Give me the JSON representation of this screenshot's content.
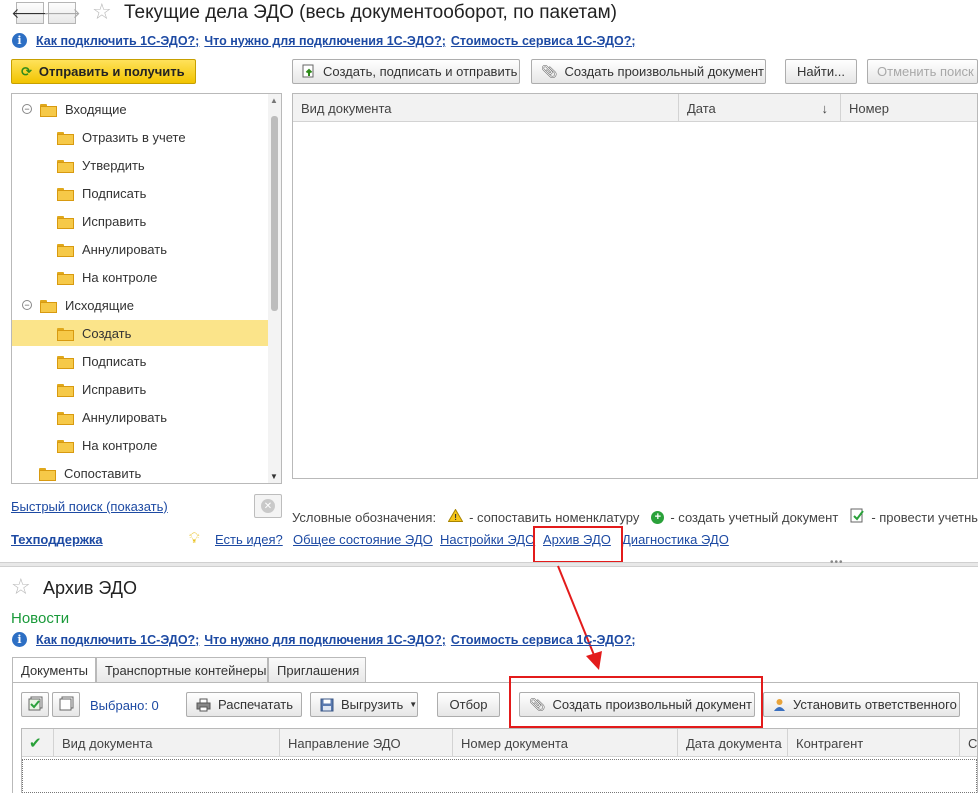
{
  "window": {
    "title": "Текущие дела ЭДО (весь документооборот, по пакетам)",
    "back_icon": "arrow-left-icon",
    "forward_icon": "arrow-right-icon"
  },
  "info_links": [
    "Как подключить 1С-ЭДО?;",
    "Что нужно для подключения 1С-ЭДО?;",
    "Стоимость сервиса 1С-ЭДО?;"
  ],
  "toolbar": {
    "send_receive": "Отправить и получить",
    "create_sign_send": "Создать, подписать и отправить",
    "create_arbitrary": "Создать произвольный документ",
    "find": "Найти...",
    "cancel_search": "Отменить поиск"
  },
  "tree": {
    "incoming": "Входящие",
    "incoming_items": [
      "Отразить в учете",
      "Утвердить",
      "Подписать",
      "Исправить",
      "Аннулировать",
      "На контроле"
    ],
    "outgoing": "Исходящие",
    "outgoing_items": [
      "Создать",
      "Подписать",
      "Исправить",
      "Аннулировать",
      "На контроле"
    ],
    "match": "Сопоставить",
    "selected": "Создать"
  },
  "main_grid": {
    "columns": [
      "Вид документа",
      "Дата",
      "Номер"
    ],
    "sort_indicator": "↓"
  },
  "quick_search": "Быстрый поиск (показать)",
  "legend": {
    "label": "Условные обозначения:",
    "items": [
      "- сопоставить номенклатуру",
      "- создать учетный документ",
      "- провести учетный до"
    ]
  },
  "footer_links": {
    "support": "Техподдержка",
    "idea": "Есть идея?",
    "links": [
      "Общее состояние ЭДО",
      "Настройки ЭДО",
      "Архив ЭДО",
      "Диагностика ЭДО"
    ]
  },
  "archive": {
    "title": "Архив ЭДО",
    "news": "Новости",
    "tabs": [
      "Документы",
      "Транспортные контейнеры",
      "Приглашения"
    ],
    "selected_count": "Выбрано: 0",
    "print": "Распечатать",
    "export": "Выгрузить",
    "filter": "Отбор",
    "create_arbitrary": "Создать произвольный документ",
    "set_responsible": "Установить ответственного",
    "columns": [
      "Вид документа",
      "Направление ЭДО",
      "Номер документа",
      "Дата документа",
      "Контрагент",
      "С"
    ]
  },
  "colors": {
    "link": "#1d4aa3",
    "highlight": "#e31b1b",
    "news": "#1a9a3a",
    "selected_row": "#fbe48a",
    "send_button": "#f2c400"
  }
}
